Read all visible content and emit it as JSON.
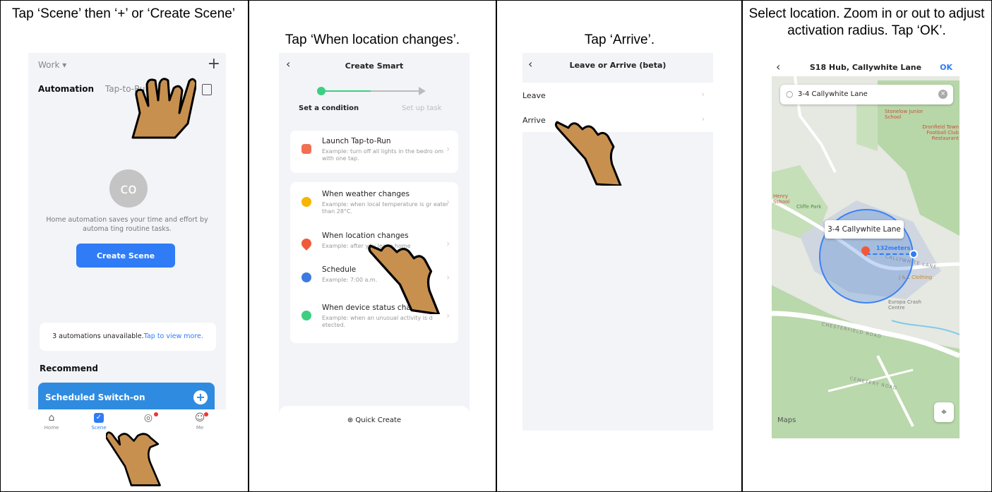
{
  "captions": {
    "step1": "Tap ‘Scene’ then ‘+’ or ‘Create Scene’",
    "step2": "Tap ‘When location changes’.",
    "step3": "Tap ‘Arrive’.",
    "step4": "Select location. Zoom in or out to adjust activation radius. Tap ‘OK’."
  },
  "screen1": {
    "home_selector": "Work ▾",
    "add_label": "+",
    "tab_automation": "Automation",
    "tab_taptorun": "Tap-to-Run",
    "empty_icon_label": "co",
    "description": "Home automation saves your time and effort by automa ting routine tasks.",
    "create_button": "Create Scene",
    "unavailable_text": "3 automations unavailable.",
    "unavailable_link": "Tap to view more.",
    "recommend_title": "Recommend",
    "recommend_card": "Scheduled Switch-on",
    "nav": [
      "Home",
      "Scene",
      "",
      "Me"
    ]
  },
  "screen2": {
    "back": "‹",
    "title": "Create Smart",
    "step_active": "Set a condition",
    "step_next": "Set up task",
    "launch": {
      "title": "Launch Tap-to-Run",
      "desc": "Example: turn off all lights in the bedro om with one tap."
    },
    "conditions": [
      {
        "title": "When weather changes",
        "desc": "Example: when local temperature is gr eater than 28°C."
      },
      {
        "title": "When location changes",
        "desc": "Example: after you leave home"
      },
      {
        "title": "Schedule",
        "desc": "Example: 7:00 a.m."
      },
      {
        "title": "When device status changes",
        "desc": "Example: when an unusual activity is d etected."
      }
    ],
    "chevron": "›",
    "quick_create": "⊕ Quick Create"
  },
  "screen3": {
    "back": "‹",
    "title": "Leave or Arrive (beta)",
    "items": [
      "Leave",
      "Arrive"
    ],
    "chevron": "›"
  },
  "screen4": {
    "back": "‹",
    "title": "S18 Hub, Callywhite Lane",
    "ok": "OK",
    "search_value": "3-4 Callywhite Lane",
    "clear": "×",
    "callout": "3-4 Callywhite Lane",
    "radius_label": "132meters",
    "pois": [
      "Stonelow Junior School",
      "Dronfield Town Football Club Restaurant",
      "Cliffe Park",
      "Henry School",
      "J & L Clothing",
      "Europa Crash Centre"
    ],
    "roads": [
      "CALLYWHITE LANE",
      "CHESTERFIELD ROAD",
      "CEMETERY ROAD"
    ],
    "attribution": "Maps",
    "recenter": "⌖"
  },
  "colors": {
    "accent": "#2f7cf6",
    "success": "#3bcf82",
    "hand": "#c8904f",
    "pin": "#f05a3a"
  }
}
